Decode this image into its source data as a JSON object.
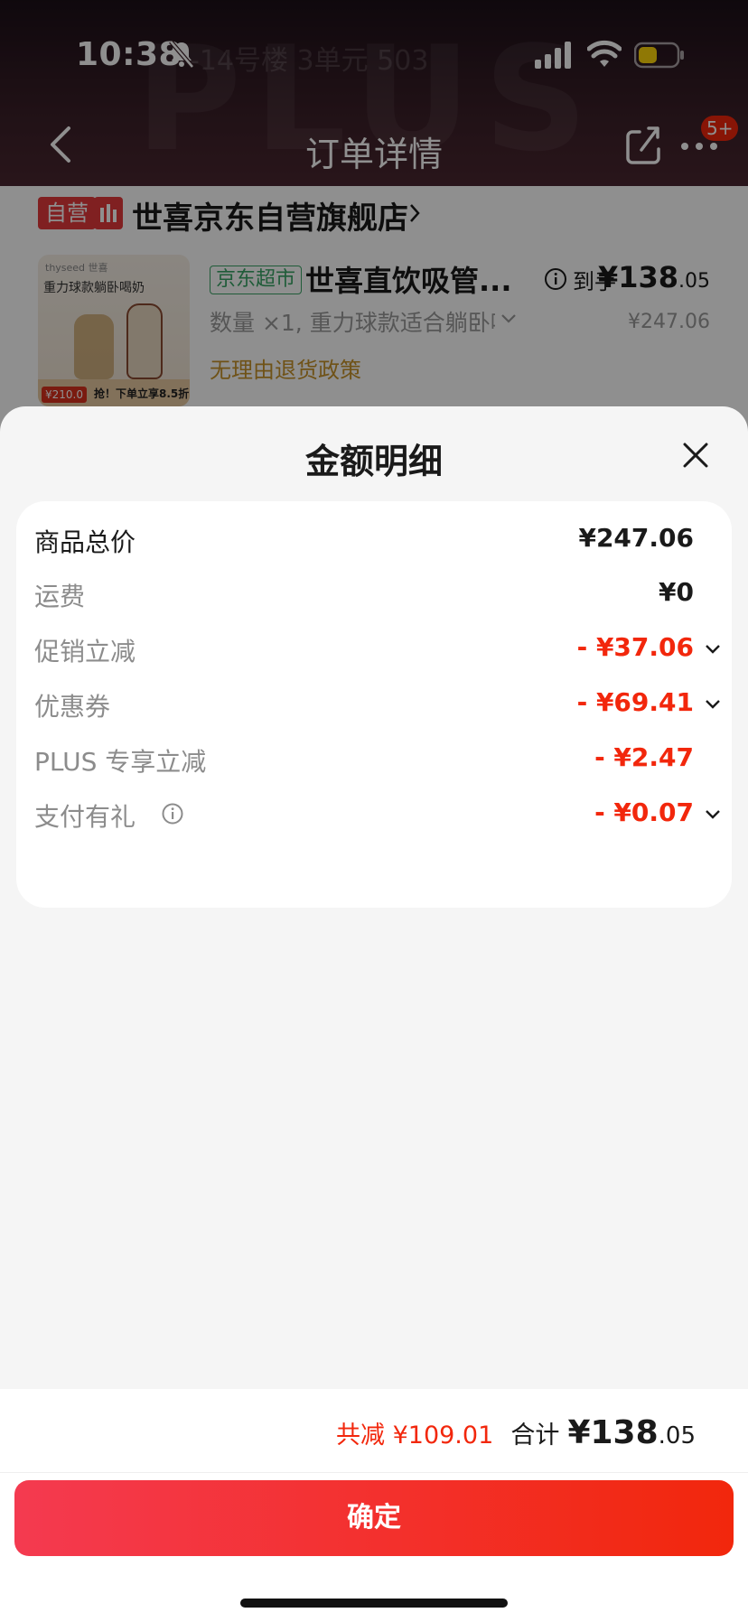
{
  "status_bar": {
    "time": "10:38"
  },
  "background": {
    "address_fragment": "-14号楼 3单元 503",
    "watermark": "PLUS",
    "nav_title": "订单详情",
    "badge": "5+",
    "self_run_tag": "自营",
    "store_name": "世喜京东自营旗舰店",
    "product": {
      "image_brand": "thyseed 世喜",
      "image_title": "重力球款躺卧喝奶",
      "image_promo": "抢！下单立享8.5折",
      "image_price": "¥210.0",
      "market_tag": "京东超市",
      "name": "世喜直饮吸管...",
      "arrive_label": "到手",
      "arrive_price_int": "¥138",
      "arrive_price_dec": ".05",
      "quantity_spec": "数量 ×1, 重力球款适合躺卧喝奶",
      "original_price": "¥247.06",
      "return_policy": "无理由退货政策"
    }
  },
  "sheet": {
    "title": "金额明细",
    "rows": [
      {
        "label": "商品总价",
        "value": "¥247.06"
      },
      {
        "label": "运费",
        "value": "¥0"
      },
      {
        "label": "促销立减",
        "value": "- ¥37.06"
      },
      {
        "label": "优惠券",
        "value": "- ¥69.41"
      },
      {
        "label": "PLUS 专享立减",
        "value": "- ¥2.47"
      },
      {
        "label": "支付有礼",
        "value": "- ¥0.07"
      }
    ]
  },
  "footer": {
    "saved_label": "共减 ¥109.01",
    "total_label": "合计",
    "total_int": "¥138",
    "total_dec": ".05",
    "confirm_label": "确定"
  },
  "colors": {
    "accent_red": "#f2270c",
    "market_green": "#39a566",
    "policy_gold": "#c7932a"
  }
}
